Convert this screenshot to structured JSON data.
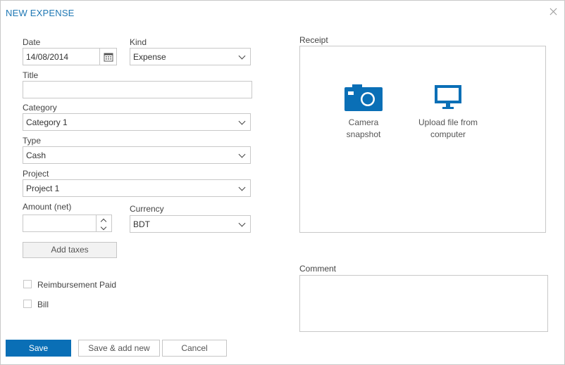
{
  "dialog": {
    "title": "NEW EXPENSE"
  },
  "colors": {
    "accent": "#0a6fb6",
    "title_color": "#1f78b4",
    "border": "#c8c8c8"
  },
  "form": {
    "date": {
      "label": "Date",
      "value": "14/08/2014"
    },
    "kind": {
      "label": "Kind",
      "value": "Expense"
    },
    "title": {
      "label": "Title",
      "value": ""
    },
    "category": {
      "label": "Category",
      "value": "Category 1"
    },
    "type": {
      "label": "Type",
      "value": "Cash"
    },
    "project": {
      "label": "Project",
      "value": "Project 1"
    },
    "amount": {
      "label": "Amount (net)",
      "value": ""
    },
    "currency": {
      "label": "Currency",
      "value": "BDT"
    },
    "add_taxes_label": "Add taxes",
    "reimbursement_paid_label": "Reimbursement Paid",
    "bill_label": "Bill"
  },
  "receipt": {
    "label": "Receipt",
    "camera": {
      "line1": "Camera",
      "line2": "snapshot",
      "icon": "camera-icon"
    },
    "upload": {
      "line1": "Upload file from",
      "line2": "computer",
      "icon": "monitor-icon"
    }
  },
  "comment": {
    "label": "Comment",
    "value": ""
  },
  "footer": {
    "save_label": "Save",
    "save_new_label": "Save & add new",
    "cancel_label": "Cancel"
  }
}
